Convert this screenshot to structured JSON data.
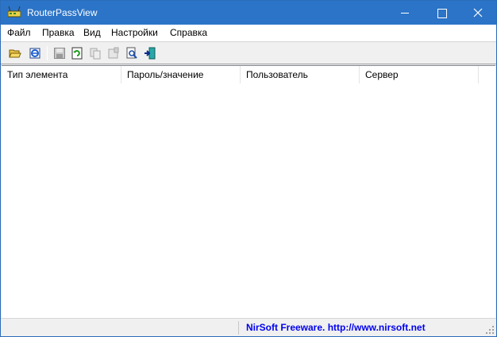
{
  "window": {
    "title": "RouterPassView",
    "icon": "router-app-icon"
  },
  "titlebar_buttons": {
    "minimize": "minimize-icon",
    "maximize": "maximize-icon",
    "close": "close-icon"
  },
  "menu": {
    "file": "Файл",
    "edit": "Правка",
    "view": "Вид",
    "settings": "Настройки",
    "help": "Справка"
  },
  "toolbar": {
    "icons": [
      "open-folder-icon",
      "open-ie-icon",
      "save-icon",
      "refresh-icon",
      "copy-icon",
      "properties-icon",
      "find-icon",
      "exit-icon"
    ]
  },
  "list": {
    "columns": [
      "Тип элемента",
      "Пароль/значение",
      "Пользователь",
      "Сервер"
    ],
    "rows": []
  },
  "status": {
    "link_text": "NirSoft Freeware.  http://www.nirsoft.net"
  },
  "colors": {
    "titlebar": "#2b74c8",
    "link": "#0000ee"
  }
}
